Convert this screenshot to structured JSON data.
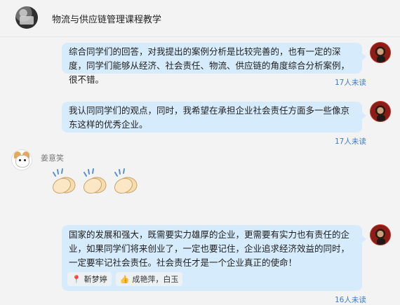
{
  "header": {
    "title": "物流与供应链管理课程教学"
  },
  "messages": [
    {
      "text": "综合同学们的回答，对我提出的案例分析是比较完善的，也有一定的深度，同学们能够从经济、社会责任、物流、供应链的角度综合分析案例，很不错。",
      "unread": "17人未读"
    },
    {
      "text": "我认同同学们的观点，同时，我希望在承担企业社会责任方面多一些像京东这样的优秀企业。",
      "unread": "17人未读"
    },
    {
      "sender": "姜意笑",
      "emoji": "clap",
      "count": 3
    },
    {
      "text": "国家的发展和强大，既需要实力雄厚的企业，更需要有实力也有责任的企业，如果同学们将来创业了，一定也要记住，企业追求经济效益的同时，一定要牢记社会责任。社会责任才是一个企业真正的使命！",
      "reactions": [
        {
          "icon": "pin-icon",
          "label": "靳梦婷"
        },
        {
          "icon": "thumbs-up-icon",
          "label": "成艳萍，白玉"
        }
      ],
      "unread": "16人未读"
    }
  ],
  "colors": {
    "bubble": "#d6ebfb",
    "unread": "#3a7bd5",
    "background": "#f3f3f3"
  }
}
